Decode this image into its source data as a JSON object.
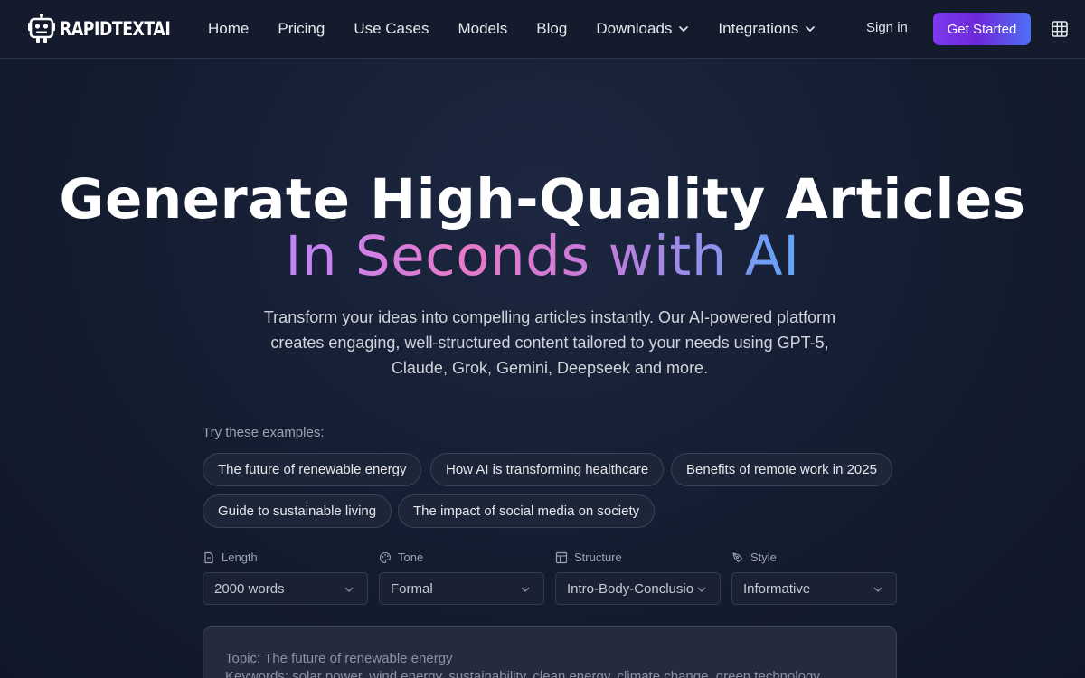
{
  "brand": {
    "name": "RAPIDTEXTAI"
  },
  "nav": {
    "links": [
      {
        "label": "Home"
      },
      {
        "label": "Pricing"
      },
      {
        "label": "Use Cases"
      },
      {
        "label": "Models"
      },
      {
        "label": "Blog"
      },
      {
        "label": "Downloads",
        "dropdown": true
      },
      {
        "label": "Integrations",
        "dropdown": true
      }
    ],
    "signin": "Sign in",
    "cta": "Get Started",
    "apps_icon": "grid-icon"
  },
  "hero": {
    "title_line1": "Generate High-Quality Articles",
    "title_line2": "In Seconds with AI",
    "subtitle": "Transform your ideas into compelling articles instantly. Our AI-powered platform creates engaging, well-structured content tailored to your needs using GPT-5, Claude, Grok, Gemini, Deepseek and more."
  },
  "examples": {
    "label": "Try these examples:",
    "items": [
      "The future of renewable energy",
      "How AI is transforming healthcare",
      "Benefits of remote work in 2025",
      "Guide to sustainable living",
      "The impact of social media on society"
    ]
  },
  "options": {
    "length": {
      "label": "Length",
      "value": "2000 words",
      "icon": "document-icon"
    },
    "tone": {
      "label": "Tone",
      "value": "Formal",
      "icon": "palette-icon"
    },
    "structure": {
      "label": "Structure",
      "value": "Intro-Body-Conclusion",
      "icon": "layout-icon"
    },
    "style": {
      "label": "Style",
      "value": "Informative",
      "icon": "pen-tool-icon"
    }
  },
  "editor": {
    "line1": "Topic: The future of renewable energy",
    "line2": "Keywords: solar power, wind energy, sustainability, clean energy, climate change, green technology"
  },
  "colors": {
    "background": "#141c30",
    "cta_start": "#7c3aed",
    "cta_end": "#4f6ef7",
    "gradient_pink": "#e879c9",
    "gradient_blue": "#60a5fa"
  }
}
